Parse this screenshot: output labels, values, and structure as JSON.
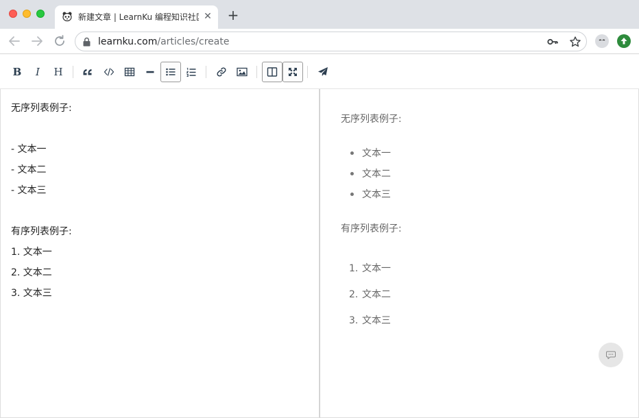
{
  "browser": {
    "tab_title": "新建文章 | LearnKu 编程知识社区",
    "tab_close": "✕",
    "new_tab": "+",
    "url_host": "learnku.com",
    "url_path": "/articles/create"
  },
  "toolbar": {
    "bold": "B",
    "italic": "I",
    "heading": "H"
  },
  "editor": {
    "lines": [
      "无序列表例子:",
      "- 文本一",
      "- 文本二",
      "- 文本三",
      "有序列表例子:",
      "1. 文本一",
      "2. 文本二",
      "3. 文本三"
    ]
  },
  "preview": {
    "unordered_heading": "无序列表例子:",
    "unordered_items": [
      "文本一",
      "文本二",
      "文本三"
    ],
    "ordered_heading": "有序列表例子:",
    "ordered_numbers": [
      "1.",
      "2.",
      "3."
    ],
    "ordered_items": [
      "文本一",
      "文本二",
      "文本三"
    ]
  },
  "colors": {
    "accent": "#2c3e50",
    "extension_green": "#2e8b3c"
  }
}
